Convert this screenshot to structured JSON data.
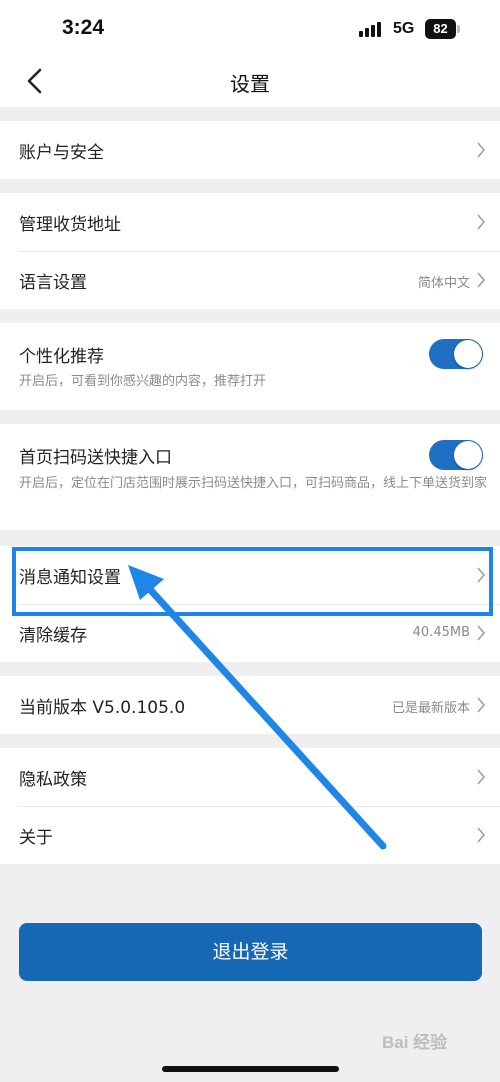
{
  "status_bar": {
    "time": "3:24",
    "network": "5G",
    "battery": "82"
  },
  "nav": {
    "title": "设置"
  },
  "groups": {
    "account": {
      "label": "账户与安全"
    },
    "address": {
      "label": "管理收货地址"
    },
    "language": {
      "label": "语言设置",
      "value": "简体中文"
    },
    "personalized": {
      "label": "个性化推荐",
      "desc": "开启后，可看到你感兴趣的内容，推荐打开",
      "enabled": true
    },
    "scan_entry": {
      "label": "首页扫码送快捷入口",
      "desc": "开启后，定位在门店范围时展示扫码送快捷入口，可扫码商品，线上下单送货到家",
      "enabled": true
    },
    "notifications": {
      "label": "消息通知设置"
    },
    "cache": {
      "label": "清除缓存",
      "value": "40.45MB"
    },
    "version": {
      "label": "当前版本 V5.0.105.0",
      "value": "已是最新版本"
    },
    "privacy": {
      "label": "隐私政策"
    },
    "about": {
      "label": "关于"
    }
  },
  "logout": {
    "label": "退出登录"
  },
  "watermark": "Bai 经验",
  "colors": {
    "accent": "#1f6fc3",
    "button": "#1667b4",
    "annotation": "#1f86e8"
  }
}
